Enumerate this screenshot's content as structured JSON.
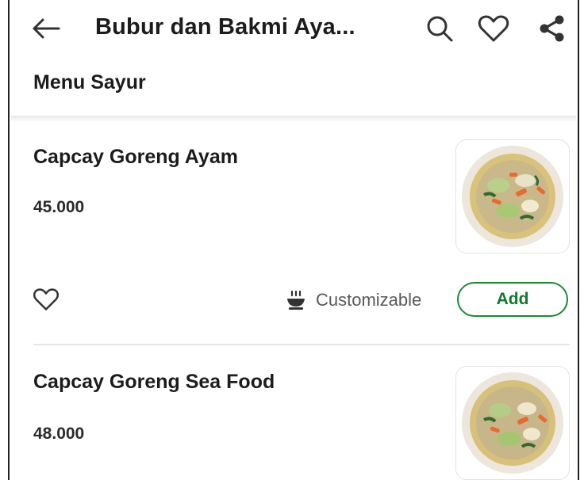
{
  "header": {
    "title": "Bubur dan Bakmi Aya...",
    "back_icon": "arrow-left-icon",
    "search_icon": "search-icon",
    "favorite_icon": "heart-outline-icon",
    "share_icon": "share-icon"
  },
  "section": {
    "title": "Menu Sayur"
  },
  "items": [
    {
      "name": "Capcay Goreng Ayam",
      "price": "45.000",
      "custom_label": "Customizable",
      "add_label": "Add"
    },
    {
      "name": "Capcay Goreng Sea Food",
      "price": "48.000"
    }
  ],
  "colors": {
    "accent_green": "#1a8a3a",
    "text_dark": "#1c1c1c",
    "text_muted": "#595959"
  }
}
